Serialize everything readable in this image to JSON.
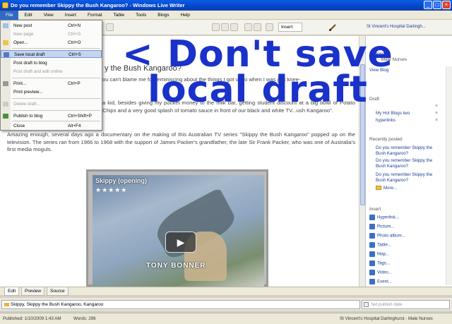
{
  "window": {
    "title": "Do you remember Skippy the Bush Kangaroo? - Windows Live Writer"
  },
  "menubar": {
    "items": [
      "File",
      "Edit",
      "View",
      "Insert",
      "Format",
      "Table",
      "Tools",
      "Blogs",
      "Help"
    ]
  },
  "toolbar": {
    "insert_label": "Insert",
    "blog_name": "St Vincent's Hospital Darlingh..."
  },
  "file_menu": {
    "items": [
      {
        "label": "New post",
        "shortcut": "Ctrl+N",
        "disabled": false
      },
      {
        "label": "New page",
        "shortcut": "Ctrl+G",
        "disabled": true
      },
      {
        "label": "Open...",
        "shortcut": "Ctrl+O",
        "disabled": false
      },
      {
        "label": "Save local draft",
        "shortcut": "Ctrl+S",
        "disabled": false,
        "highlight": true
      },
      {
        "label": "Post draft to blog",
        "shortcut": "",
        "disabled": false
      },
      {
        "label": "Post draft and edit online",
        "shortcut": "",
        "disabled": true
      },
      {
        "label": "Print...",
        "shortcut": "Ctrl+P",
        "disabled": false
      },
      {
        "label": "Print preview...",
        "shortcut": "",
        "disabled": false
      },
      {
        "label": "Delete draft...",
        "shortcut": "",
        "disabled": true
      },
      {
        "label": "Publish to blog",
        "shortcut": "Ctrl+Shift+P",
        "disabled": false
      },
      {
        "label": "Close",
        "shortcut": "Alt+F4",
        "disabled": false
      }
    ]
  },
  "overlay": {
    "line1": "< Don't save",
    "line2": "local draft"
  },
  "editor": {
    "title": "y the Bush Kangaroo?",
    "p1": "ou can't blame me for reminiscing about the things I got up to when I was just knee-",
    "p2": "a kid, besides giving my pocket money to the milk bar, getting student discount at a big bowl of Potato Chips and a very good splash of tomato sauce in front of our black and white TV...ush Kangaroo\".",
    "p3": "Amazing enough, several days ago a documentary on the making of this Australian TV series \"Skippy the Bush Kangaroo\" popped up on the television. The series ran from 1966 to 1968 with the support of James Packer's grandfather, the late Sir Frank Packer, who was one of Australia's first media moguls."
  },
  "video": {
    "title": "Skippy (opening)",
    "stars": "★★★★★",
    "caption": "TONY   BONNER"
  },
  "sidebar": {
    "blog_title_1": "'s Hospital",
    "blog_title_2": "urst - Male Nurses",
    "view_blog": "View Blog",
    "drafts_head": "Draft",
    "draft_item_1": "My Hot Blogs two",
    "draft_item_2": "hyperlinks",
    "recent_head": "Recently posted",
    "recent": [
      "Do you remember Skippy the Bush Kangaroo?",
      "Do you remember Skippy the Bush Kangaroo?",
      "Do you remember Skippy the Bush Kangaroo?"
    ],
    "more": "More...",
    "insert_head": "Insert",
    "insert_items": [
      "Hyperlink...",
      "Picture...",
      "Photo album...",
      "Table...",
      "Map...",
      "Tags...",
      "Video...",
      "Event..."
    ]
  },
  "tabs": [
    "Edit",
    "Preview",
    "Source"
  ],
  "tagbar": {
    "tags": "Skippy, Skippy the Bush Kangaroo, Kangaroo",
    "date_placeholder": "Set publish date"
  },
  "statusbar": {
    "published": "Published: 1/10/2009 1:43 AM",
    "words": "Words: 296",
    "blog": "St Vincent's Hospital Darlinghurst - Male Nurses"
  }
}
